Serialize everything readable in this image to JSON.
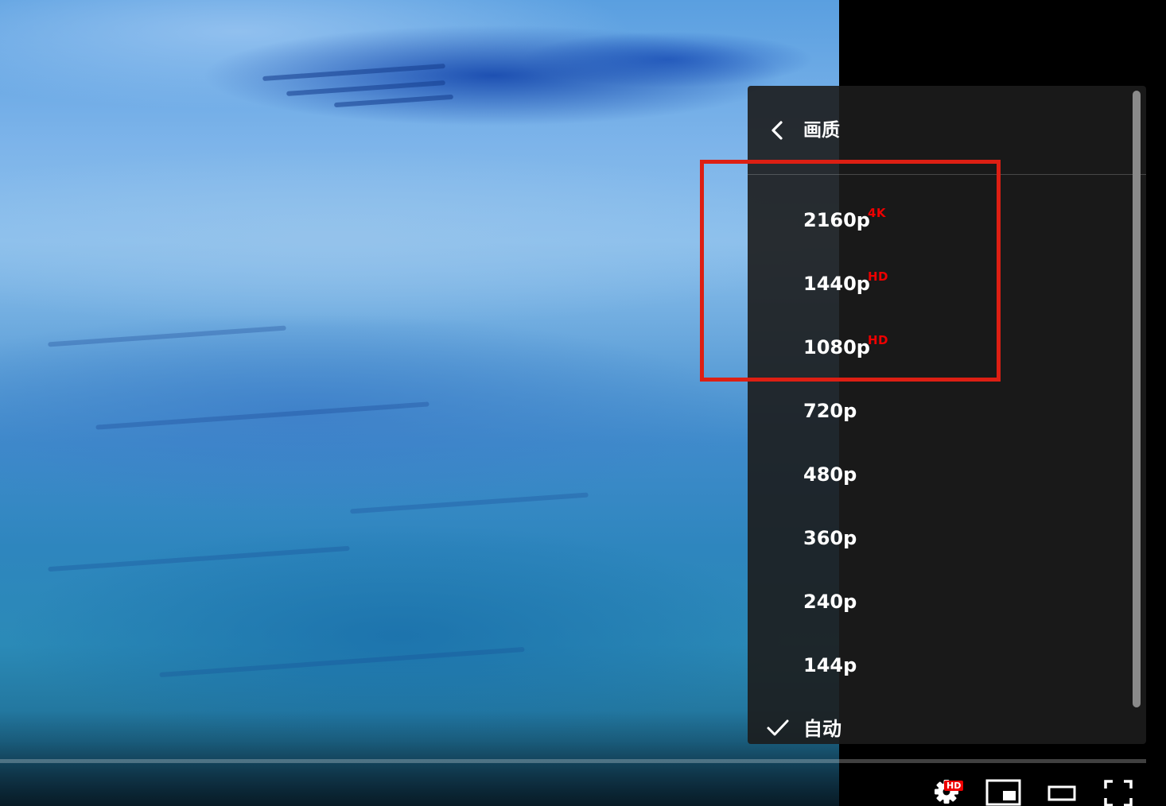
{
  "menu": {
    "title": "画质",
    "back_icon": "chevron-left-icon",
    "items": [
      {
        "label": "2160p",
        "badge": "4K",
        "selected": false
      },
      {
        "label": "1440p",
        "badge": "HD",
        "selected": false
      },
      {
        "label": "1080p",
        "badge": "HD",
        "selected": false
      },
      {
        "label": "720p",
        "badge": "",
        "selected": false
      },
      {
        "label": "480p",
        "badge": "",
        "selected": false
      },
      {
        "label": "360p",
        "badge": "",
        "selected": false
      },
      {
        "label": "240p",
        "badge": "",
        "selected": false
      },
      {
        "label": "144p",
        "badge": "",
        "selected": false
      },
      {
        "label": "自动",
        "badge": "",
        "selected": true
      }
    ]
  },
  "controls": {
    "settings_icon": "gear-icon",
    "settings_badge": "HD",
    "miniplayer_icon": "miniplayer-icon",
    "theater_icon": "theater-mode-icon",
    "fullscreen_icon": "fullscreen-icon"
  },
  "colors": {
    "badge_red": "#ee0000",
    "highlight_red": "#dd1f13",
    "menu_bg": "#1c1c1c"
  }
}
